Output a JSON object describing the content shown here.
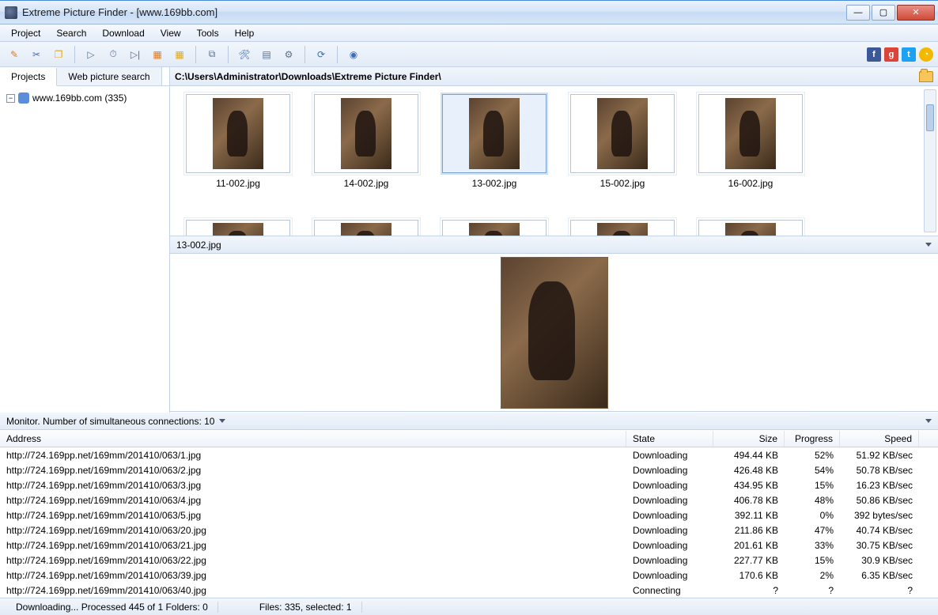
{
  "window": {
    "title": "Extreme Picture Finder - [www.169bb.com]"
  },
  "menu": {
    "items": [
      "Project",
      "Search",
      "Download",
      "View",
      "Tools",
      "Help"
    ]
  },
  "toolbar": {
    "buttons": [
      {
        "name": "new-project-icon",
        "glyph": "✎",
        "color": "#e07b1c"
      },
      {
        "name": "project-settings-icon",
        "glyph": "✂",
        "color": "#3a6db8"
      },
      {
        "name": "highlight-icon",
        "glyph": "❐",
        "color": "#e0a81c"
      },
      {
        "sep": true
      },
      {
        "name": "play-icon",
        "glyph": "▷",
        "color": "#5a7090"
      },
      {
        "name": "pause-icon",
        "glyph": "⏱",
        "color": "#5a7090"
      },
      {
        "name": "skip-icon",
        "glyph": "▷|",
        "color": "#5a7090"
      },
      {
        "name": "grid1-icon",
        "glyph": "▦",
        "color": "#e07b1c"
      },
      {
        "name": "grid2-icon",
        "glyph": "▦",
        "color": "#e0a81c"
      },
      {
        "sep": true
      },
      {
        "name": "copy-icon",
        "glyph": "⧉",
        "color": "#5a7090"
      },
      {
        "sep": true
      },
      {
        "name": "tool1-icon",
        "glyph": "🛠",
        "color": "#3a6db8"
      },
      {
        "name": "layout-icon",
        "glyph": "▤",
        "color": "#5a7090"
      },
      {
        "name": "gear-icon",
        "glyph": "⚙",
        "color": "#5a7090"
      },
      {
        "sep": true
      },
      {
        "name": "refresh-icon",
        "glyph": "⟳",
        "color": "#3a6db8"
      },
      {
        "sep": true
      },
      {
        "name": "help-icon",
        "glyph": "◉",
        "color": "#3a6db8"
      }
    ]
  },
  "left": {
    "tabs": [
      {
        "label": "Projects",
        "active": true
      },
      {
        "label": "Web picture search",
        "active": false
      }
    ],
    "tree": [
      {
        "label": "www.169bb.com (335)"
      }
    ]
  },
  "path": "C:\\Users\\Administrator\\Downloads\\Extreme Picture Finder\\",
  "thumbs": {
    "row1": [
      {
        "name": "11-002.jpg",
        "selected": false
      },
      {
        "name": "14-002.jpg",
        "selected": false
      },
      {
        "name": "13-002.jpg",
        "selected": true
      },
      {
        "name": "15-002.jpg",
        "selected": false
      },
      {
        "name": "16-002.jpg",
        "selected": false
      }
    ],
    "row2": [
      "",
      "",
      "",
      "",
      ""
    ]
  },
  "preview": {
    "name": "13-002.jpg"
  },
  "monitor": {
    "label": "Monitor. Number of simultaneous connections: 10"
  },
  "columns": {
    "address": "Address",
    "state": "State",
    "size": "Size",
    "progress": "Progress",
    "speed": "Speed"
  },
  "downloads": [
    {
      "addr": "http://724.169pp.net/169mm/201410/063/1.jpg",
      "state": "Downloading",
      "size": "494.44 KB",
      "prog": "52%",
      "speed": "51.92 KB/sec"
    },
    {
      "addr": "http://724.169pp.net/169mm/201410/063/2.jpg",
      "state": "Downloading",
      "size": "426.48 KB",
      "prog": "54%",
      "speed": "50.78 KB/sec"
    },
    {
      "addr": "http://724.169pp.net/169mm/201410/063/3.jpg",
      "state": "Downloading",
      "size": "434.95 KB",
      "prog": "15%",
      "speed": "16.23 KB/sec"
    },
    {
      "addr": "http://724.169pp.net/169mm/201410/063/4.jpg",
      "state": "Downloading",
      "size": "406.78 KB",
      "prog": "48%",
      "speed": "50.86 KB/sec"
    },
    {
      "addr": "http://724.169pp.net/169mm/201410/063/5.jpg",
      "state": "Downloading",
      "size": "392.11 KB",
      "prog": "0%",
      "speed": "392 bytes/sec"
    },
    {
      "addr": "http://724.169pp.net/169mm/201410/063/20.jpg",
      "state": "Downloading",
      "size": "211.86 KB",
      "prog": "47%",
      "speed": "40.74 KB/sec"
    },
    {
      "addr": "http://724.169pp.net/169mm/201410/063/21.jpg",
      "state": "Downloading",
      "size": "201.61 KB",
      "prog": "33%",
      "speed": "30.75 KB/sec"
    },
    {
      "addr": "http://724.169pp.net/169mm/201410/063/22.jpg",
      "state": "Downloading",
      "size": "227.77 KB",
      "prog": "15%",
      "speed": "30.9 KB/sec"
    },
    {
      "addr": "http://724.169pp.net/169mm/201410/063/39.jpg",
      "state": "Downloading",
      "size": "170.6 KB",
      "prog": "2%",
      "speed": "6.35 KB/sec"
    },
    {
      "addr": "http://724.169pp.net/169mm/201410/063/40.jpg",
      "state": "Connecting",
      "size": "?",
      "prog": "?",
      "speed": "?"
    }
  ],
  "status": {
    "left": "Downloading... Processed 445 of 1 Folders: 0",
    "mid": "Files: 335, selected: 1"
  }
}
